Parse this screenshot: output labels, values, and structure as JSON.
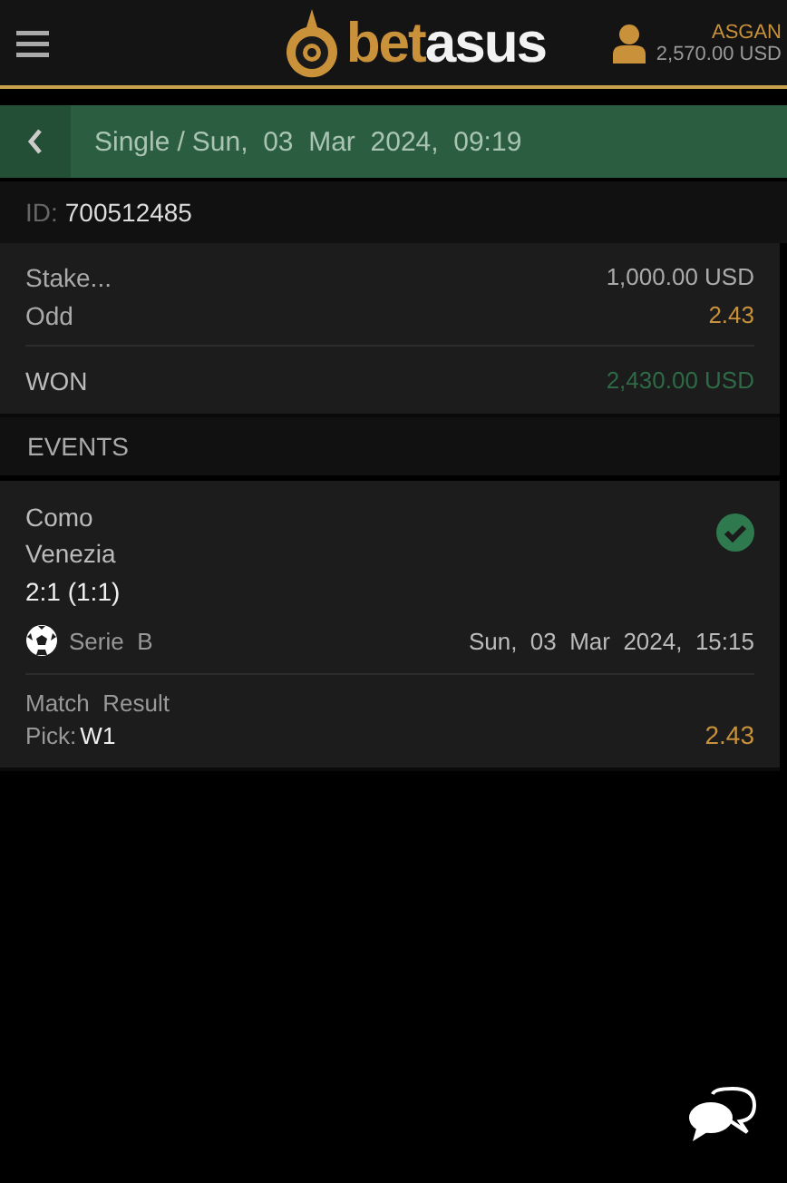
{
  "header": {
    "logo": {
      "accent": "bet",
      "rest": "asus"
    },
    "user": {
      "name": "ASGAN",
      "balance": "2,570.00 USD"
    }
  },
  "title_bar": {
    "type": "Single",
    "separator": "/",
    "date": "Sun,  03  Mar  2024,  09:19"
  },
  "bet_id": {
    "label": "ID:",
    "value": "700512485"
  },
  "summary": [
    {
      "label": "Stake...",
      "value": "1,000.00 USD",
      "kind": "plain"
    },
    {
      "label": "Odd",
      "value": "2.43",
      "kind": "odd"
    }
  ],
  "result": {
    "label": "WON",
    "value": "2,430.00 USD",
    "won": true
  },
  "events_title": "EVENTS",
  "events": [
    {
      "home": "Como",
      "away": "Venezia",
      "score": "2:1 (1:1)",
      "won": true,
      "kind": "football",
      "league": "Serie  B",
      "date": "Sun,  03  Mar  2024,  15:15",
      "market": "Match  Result",
      "pick_label": "Pick:",
      "pick": "W1",
      "odd": "2.43"
    }
  ]
}
